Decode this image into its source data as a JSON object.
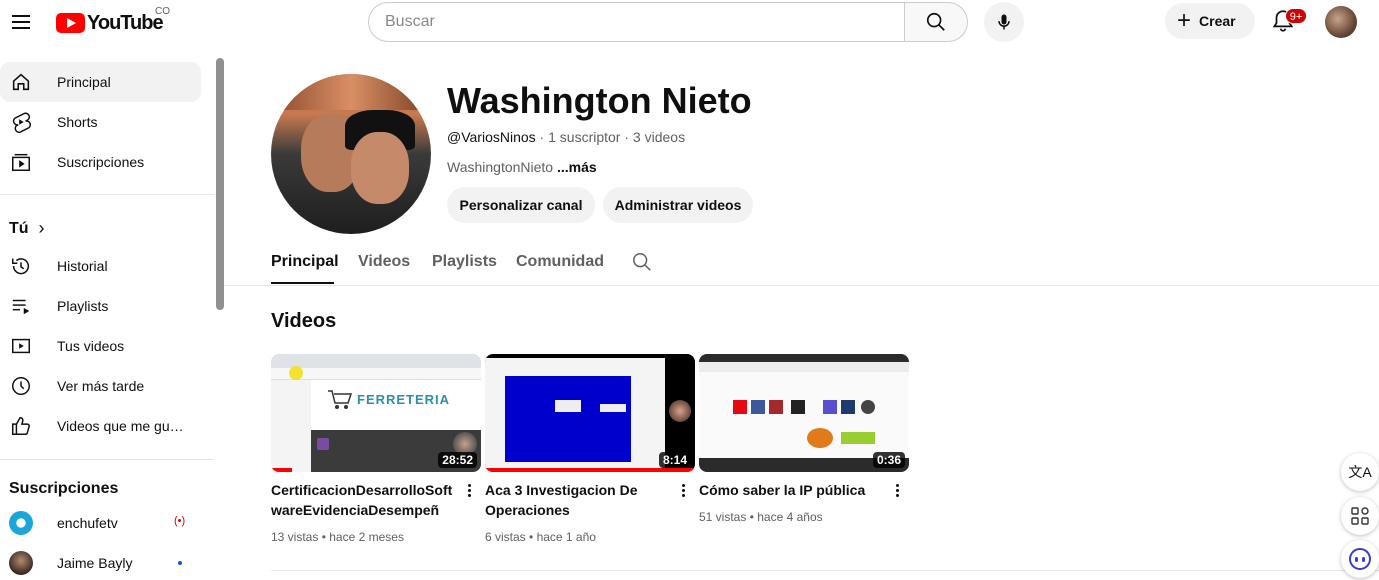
{
  "header": {
    "logo_text": "YouTube",
    "country_code": "CO",
    "search_placeholder": "Buscar",
    "create_label": "Crear",
    "notification_count": "9+"
  },
  "sidebar": {
    "main_items": [
      {
        "label": "Principal",
        "icon": "home-icon",
        "active": true
      },
      {
        "label": "Shorts",
        "icon": "shorts-icon"
      },
      {
        "label": "Suscripciones",
        "icon": "subscriptions-icon"
      }
    ],
    "you_heading": "Tú",
    "you_items": [
      {
        "label": "Historial",
        "icon": "history-icon"
      },
      {
        "label": "Playlists",
        "icon": "playlists-icon"
      },
      {
        "label": "Tus videos",
        "icon": "your-videos-icon"
      },
      {
        "label": "Ver más tarde",
        "icon": "watch-later-icon"
      },
      {
        "label": "Videos que me gus…",
        "icon": "like-icon"
      }
    ],
    "subscriptions_heading": "Suscripciones",
    "subscriptions": [
      {
        "name": "enchufetv",
        "status": "live"
      },
      {
        "name": "Jaime Bayly",
        "status": "new"
      }
    ]
  },
  "channel": {
    "name": "Washington Nieto",
    "handle": "@VariosNinos",
    "subscribers": "1 suscriptor",
    "video_count": "3 videos",
    "description": "WashingtonNieto",
    "more_label": "...más",
    "customize_label": "Personalizar canal",
    "manage_label": "Administrar videos"
  },
  "tabs": [
    {
      "label": "Principal",
      "active": true
    },
    {
      "label": "Videos"
    },
    {
      "label": "Playlists"
    },
    {
      "label": "Comunidad"
    }
  ],
  "section_title": "Videos",
  "videos": [
    {
      "title": "CertificacionDesarrolloSoftwareEvidenciaDesempeño…",
      "duration": "28:52",
      "views": "13 vistas",
      "age": "hace 2 meses",
      "watched_fraction": 0.1
    },
    {
      "title": "Aca 3 Investigacion De Operaciones",
      "duration": "8:14",
      "views": "6 vistas",
      "age": "hace 1 año",
      "watched_fraction": 1.0
    },
    {
      "title": "Cómo saber la IP pública",
      "duration": "0:36",
      "views": "51 vistas",
      "age": "hace 4 años",
      "watched_fraction": 0
    }
  ],
  "thumb_texts": {
    "ferreteria": "FERRETERIA"
  }
}
